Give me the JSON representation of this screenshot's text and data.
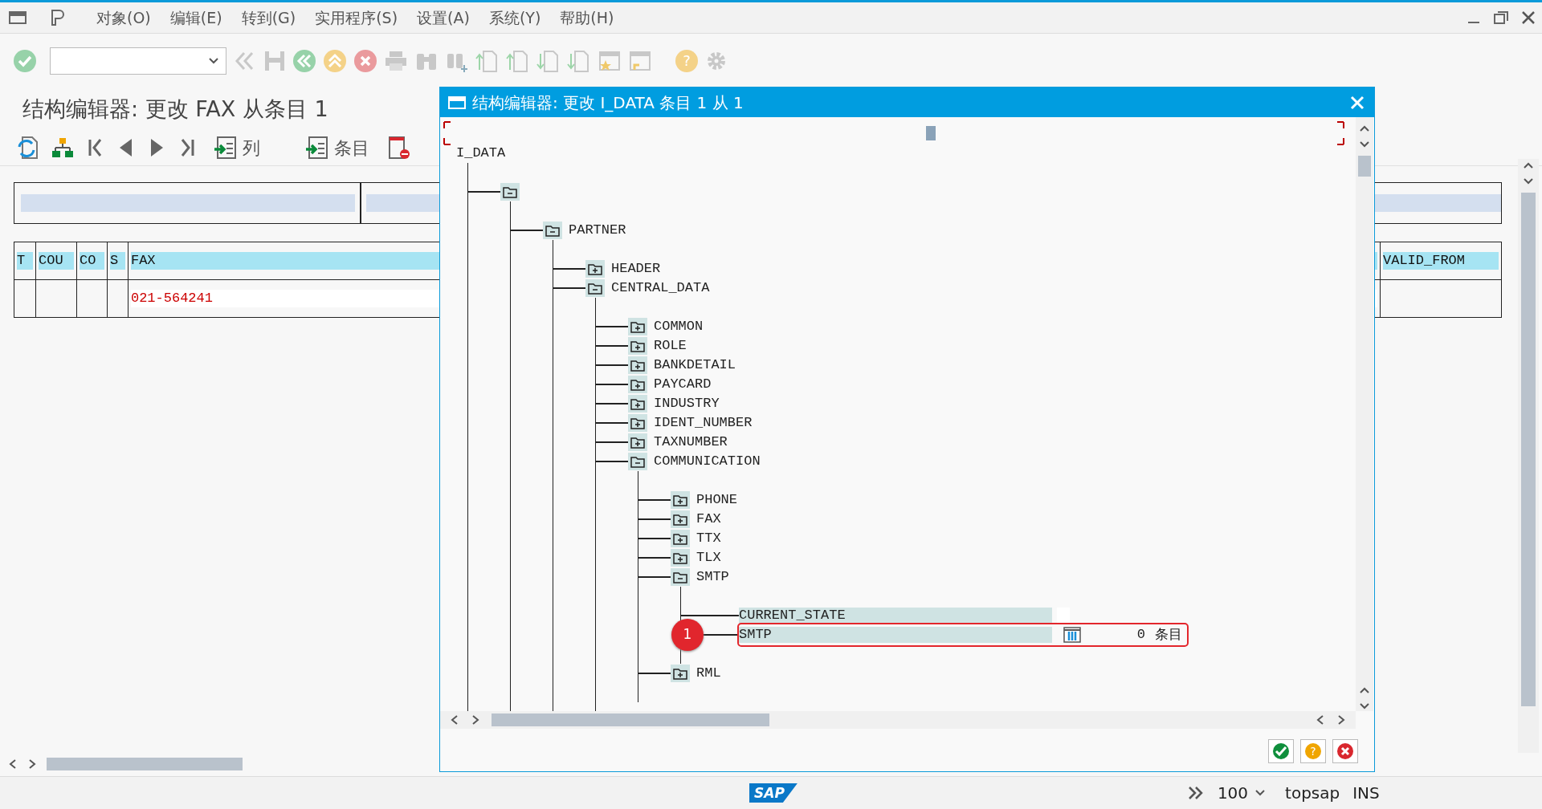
{
  "toolbar": {
    "help_icon": "?"
  },
  "menu_bar": {
    "items": [
      {
        "label": "对象(O)"
      },
      {
        "label": "编辑(E)"
      },
      {
        "label": "转到(G)"
      },
      {
        "label": "实用程序(S)"
      },
      {
        "label": "设置(A)"
      },
      {
        "label": "系统(Y)"
      },
      {
        "label": "帮助(H)"
      }
    ]
  },
  "page_title": "结构编辑器: 更改 FAX 从条目 1",
  "app_toolbar": {
    "buttons": [
      {
        "label": "列"
      },
      {
        "label": "条目"
      }
    ]
  },
  "table": {
    "columns": [
      "T",
      "COU",
      "CO",
      "S",
      "FAX",
      "VALID_FROM"
    ],
    "rows": [
      {
        "cells": [
          null,
          null,
          null,
          null,
          "021-564241",
          null
        ]
      }
    ]
  },
  "dialog": {
    "title": "结构编辑器: 更改 I_DATA 条目 1 从 1",
    "help_button": "?",
    "tree": {
      "kind": "root",
      "label": "I_DATA",
      "children": [
        {
          "kind": "folder",
          "expanded": true,
          "children": [
            {
              "kind": "folder",
              "label": "PARTNER",
              "expanded": true,
              "children": [
                {
                  "kind": "folder",
                  "label": "HEADER",
                  "expanded": false
                },
                {
                  "kind": "folder",
                  "label": "CENTRAL_DATA",
                  "expanded": true,
                  "children": [
                    {
                      "kind": "folder",
                      "label": "COMMON",
                      "expanded": false
                    },
                    {
                      "kind": "folder",
                      "label": "ROLE",
                      "expanded": false
                    },
                    {
                      "kind": "folder",
                      "label": "BANKDETAIL",
                      "expanded": false
                    },
                    {
                      "kind": "folder",
                      "label": "PAYCARD",
                      "expanded": false
                    },
                    {
                      "kind": "folder",
                      "label": "INDUSTRY",
                      "expanded": false
                    },
                    {
                      "kind": "folder",
                      "label": "IDENT_NUMBER",
                      "expanded": false
                    },
                    {
                      "kind": "folder",
                      "label": "TAXNUMBER",
                      "expanded": false
                    },
                    {
                      "kind": "folder",
                      "label": "COMMUNICATION",
                      "expanded": true,
                      "children": [
                        {
                          "kind": "folder",
                          "label": "PHONE",
                          "expanded": false
                        },
                        {
                          "kind": "folder",
                          "label": "FAX",
                          "expanded": false
                        },
                        {
                          "kind": "folder",
                          "label": "TTX",
                          "expanded": false
                        },
                        {
                          "kind": "folder",
                          "label": "TLX",
                          "expanded": false
                        },
                        {
                          "kind": "folder",
                          "label": "SMTP",
                          "expanded": true,
                          "children": [
                            {
                              "kind": "field",
                              "label": "CURRENT_STATE",
                              "highlighted": false
                            },
                            {
                              "kind": "table",
                              "label": "SMTP",
                              "count": "0",
                              "unit": "条目",
                              "highlighted": true,
                              "callout": "1"
                            }
                          ]
                        },
                        {
                          "kind": "folder",
                          "label": "RML",
                          "expanded": false
                        }
                      ]
                    }
                  ]
                }
              ]
            }
          ]
        }
      ]
    }
  },
  "status_bar": {
    "logo": "SAP",
    "zoom": "100",
    "system": "topsap",
    "mode": "INS"
  }
}
